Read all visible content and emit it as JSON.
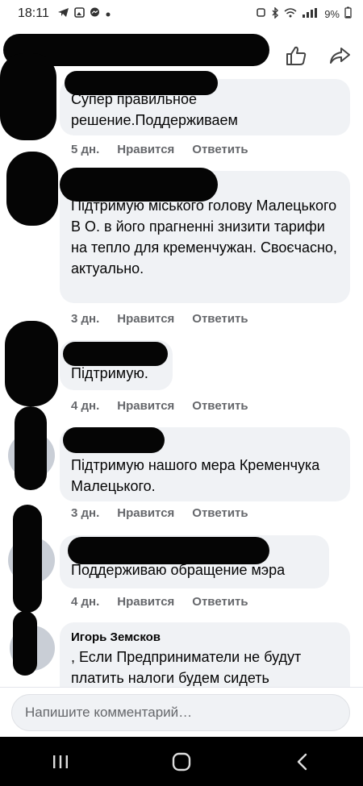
{
  "status_bar": {
    "time": "18:11",
    "battery": "9%",
    "left_icons": [
      "telegram-icon",
      "photos-icon",
      "messenger-icon",
      "dot-icon"
    ],
    "right_icons": [
      "alarm-icon",
      "bluetooth-icon",
      "wifi-icon",
      "signal-icon",
      "battery-icon"
    ]
  },
  "top_actions": {
    "like_icon": "thumbs-up-icon",
    "share_icon": "share-arrow-icon"
  },
  "comments": [
    {
      "author": "",
      "text": "Супер правильное решение.Поддерживаем",
      "age": "5 дн.",
      "like_label": "Нравится",
      "reply_label": "Ответить"
    },
    {
      "author": "",
      "text": "Підтримую міського голову Малецького В О. в його прагненні знизити тарифи на тепло для кременчужан. Своєчасно, актуально.",
      "age": "3 дн.",
      "like_label": "Нравится",
      "reply_label": "Ответить"
    },
    {
      "author": "",
      "text": "Підтримую.",
      "age": "4 дн.",
      "like_label": "Нравится",
      "reply_label": "Ответить"
    },
    {
      "author": "",
      "text": "Підтримую нашого мера Кременчука  Малецького.",
      "age": "3 дн.",
      "like_label": "Нравится",
      "reply_label": "Ответить"
    },
    {
      "author": "",
      "text": "Поддерживаю обращение мэра",
      "age": "4 дн.",
      "like_label": "Нравится",
      "reply_label": "Ответить"
    },
    {
      "author": "Игорь Земсков",
      "text": ",  Если Предприниматели не будут платить  налоги будем     сидеть",
      "age": "",
      "like_label": "",
      "reply_label": ""
    }
  ],
  "composer": {
    "placeholder": "Напишите комментарий…"
  },
  "nav": {
    "recents_icon": "recent-apps-icon",
    "home_icon": "home-icon",
    "back_icon": "back-icon"
  },
  "colors": {
    "bubble_bg": "#f0f2f5",
    "meta_text": "#65676b",
    "nav_bg": "#000000"
  }
}
